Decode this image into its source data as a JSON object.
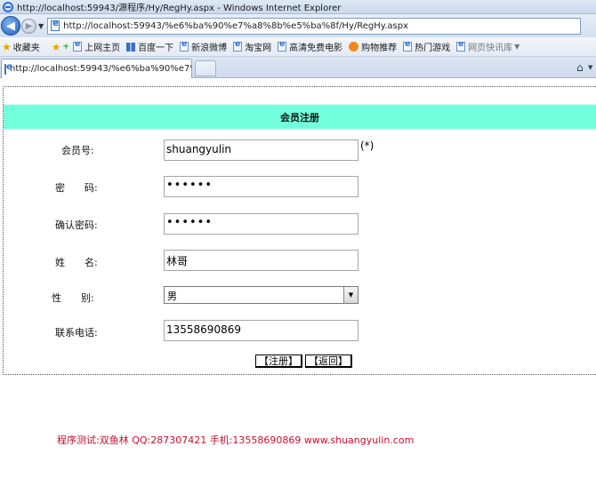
{
  "window": {
    "title": "http://localhost:59943/源程序/Hy/RegHy.aspx - Windows Internet Explorer"
  },
  "address": {
    "url": "http://localhost:59943/%e6%ba%90%e7%a8%8b%e5%ba%8f/Hy/RegHy.aspx"
  },
  "favorites": {
    "label": "收藏夹",
    "items": [
      "上网主页",
      "百度一下",
      "新浪微博",
      "淘宝网",
      "高清免费电影",
      "购物推荐",
      "热门游戏",
      "网页快讯库"
    ]
  },
  "tab": {
    "label": "http://localhost:59943/%e6%ba%90%e7%a8%8..."
  },
  "form": {
    "header": "会员注册",
    "member_id_label": "会员号:",
    "member_id_value": "shuangyulin",
    "required_mark": "(*)",
    "password_label": "密　　码:",
    "password_value": "••••••",
    "confirm_label": "确认密码:",
    "confirm_value": "••••••",
    "name_label": "姓　　名:",
    "name_value": "林哥",
    "gender_label": "性　　别:",
    "gender_value": "男",
    "phone_label": "联系电话:",
    "phone_value": "13558690869",
    "register_button": "【注册】",
    "back_button": "【返回】"
  },
  "footer": {
    "text": "程序测试:双鱼林 QQ:287307421 手机:13558690869 www.shuangyulin.com"
  }
}
